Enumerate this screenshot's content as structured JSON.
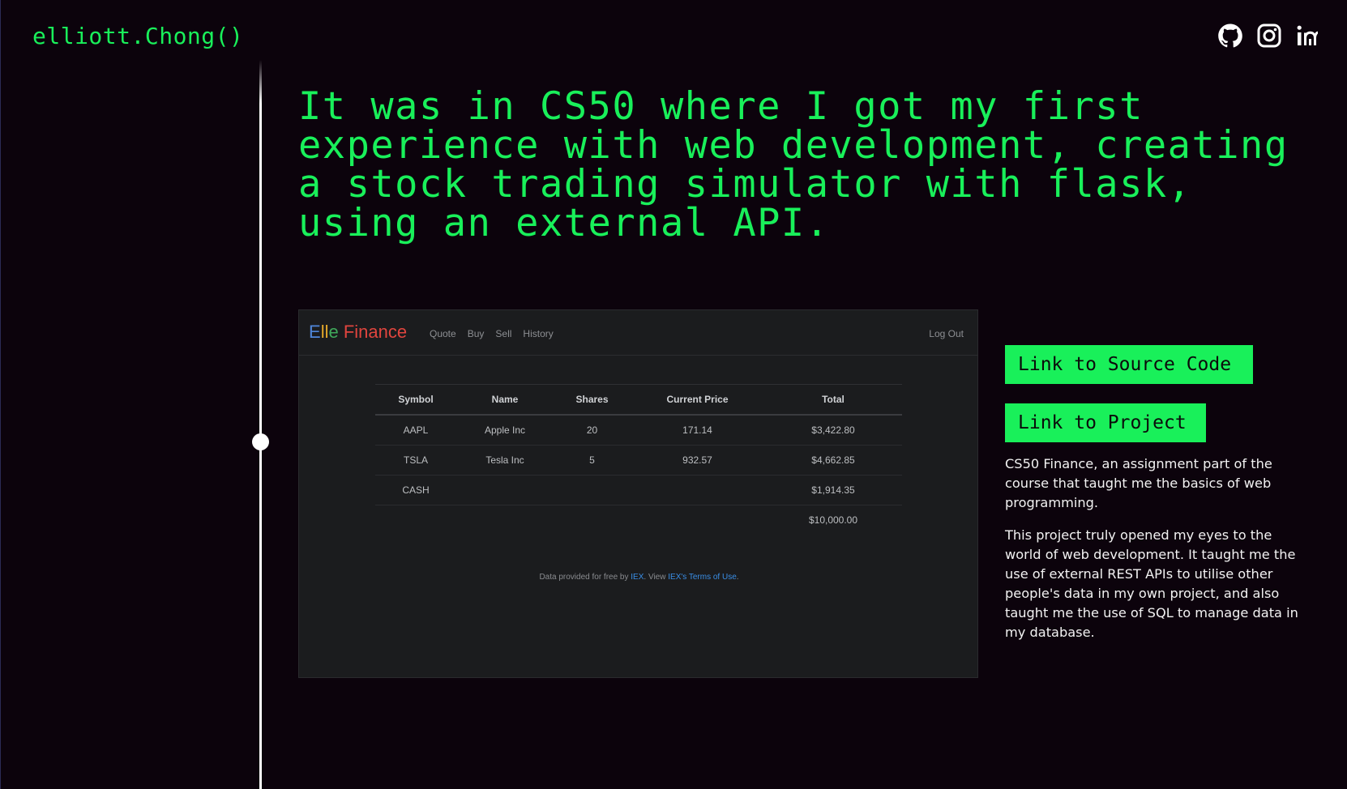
{
  "header": {
    "logo": "elliott.Chong()",
    "socials": [
      {
        "icon": "github-icon"
      },
      {
        "icon": "instagram-icon"
      },
      {
        "icon": "linkedin-icon"
      }
    ]
  },
  "colors": {
    "accent": "#19f05a",
    "background": "#0c030c",
    "timeline": "#ffffff"
  },
  "headline": "It was in CS50 where I got my first experience with web development, creating a stock trading simulator with flask, using an external API.",
  "screenshot": {
    "brand": {
      "part1": "E",
      "part2": "ll",
      "part3": "e",
      "part4": " Finance"
    },
    "nav": [
      "Quote",
      "Buy",
      "Sell",
      "History"
    ],
    "logout": "Log Out",
    "table": {
      "headers": [
        "Symbol",
        "Name",
        "Shares",
        "Current Price",
        "Total"
      ],
      "rows": [
        [
          "AAPL",
          "Apple Inc",
          "20",
          "171.14",
          "$3,422.80"
        ],
        [
          "TSLA",
          "Tesla Inc",
          "5",
          "932.57",
          "$4,662.85"
        ],
        [
          "CASH",
          "",
          "",
          "",
          "$1,914.35"
        ]
      ],
      "grand_total": "$10,000.00"
    },
    "footer": {
      "prefix": "Data provided for free by ",
      "link1": "IEX",
      "middle": ". View ",
      "link2": "IEX's Terms of Use",
      "suffix": "."
    }
  },
  "buttons": {
    "source": "Link to Source Code",
    "project": "Link to Project"
  },
  "description": [
    "CS50 Finance, an assignment part of the course that taught me the basics of web programming.",
    "This project truly opened my eyes to the world of web development. It taught me the use of external REST APIs to utilise other people's data in my own project, and also taught me the use of SQL to manage data in my database."
  ]
}
